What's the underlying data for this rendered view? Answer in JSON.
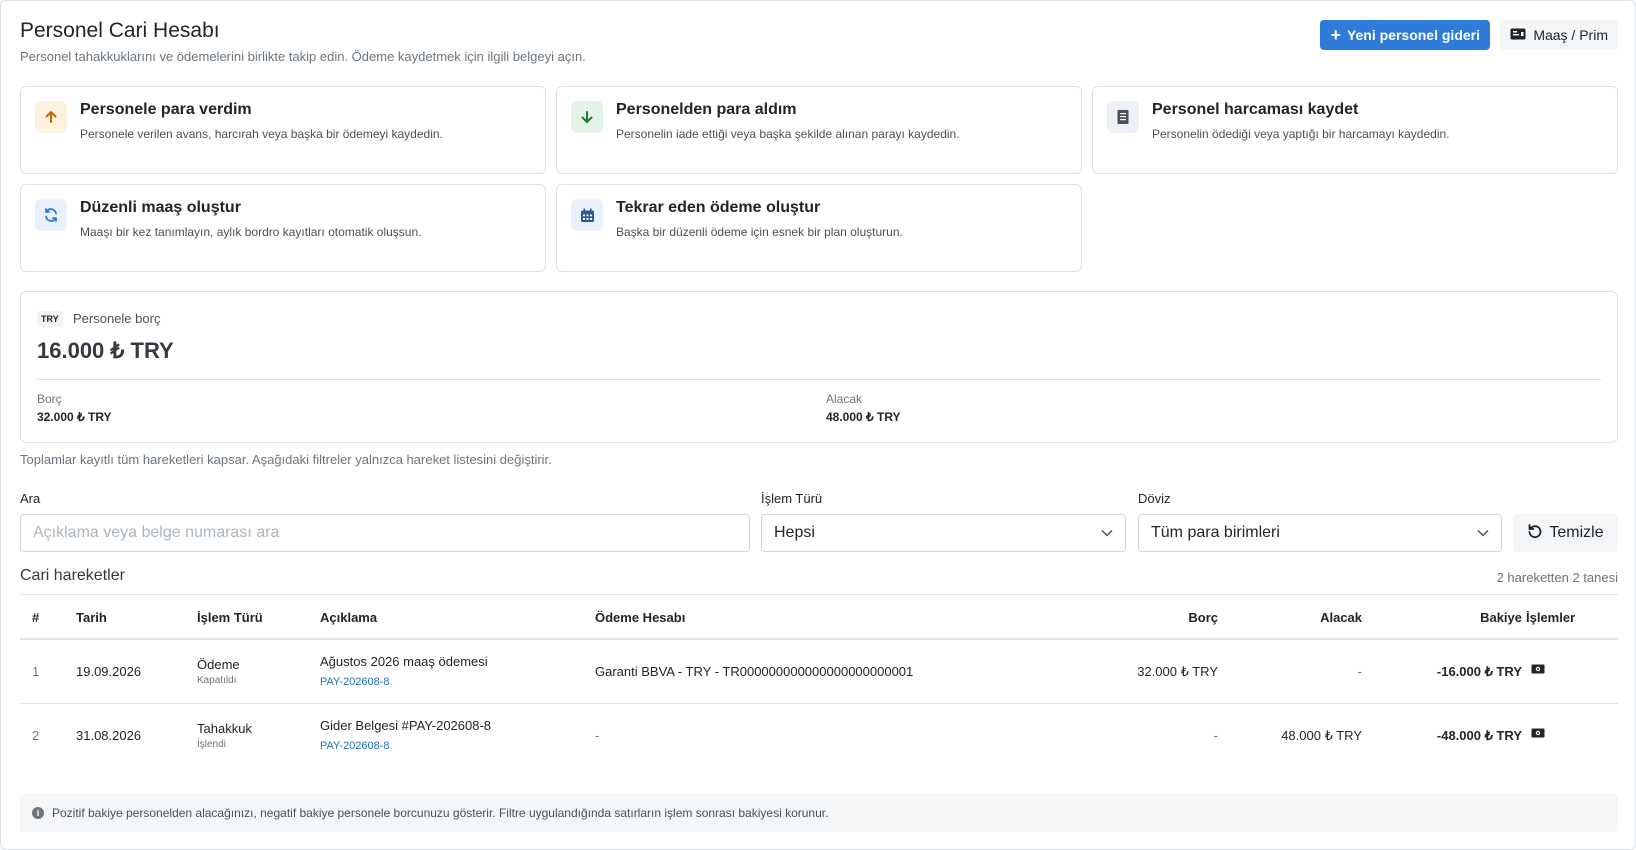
{
  "header": {
    "title": "Personel Cari Hesabı",
    "subtitle": "Personel tahakkuklarını ve ödemelerini birlikte takip edin. Ödeme kaydetmek için ilgili belgeyi açın.",
    "new_expense_label": "Yeni personel gideri",
    "salary_label": "Maaş / Prim"
  },
  "actions": [
    {
      "title": "Personele para verdim",
      "desc": "Personele verilen avans, harcırah veya başka bir ödemeyi kaydedin.",
      "icon": "arrow-up-icon"
    },
    {
      "title": "Personelden para aldım",
      "desc": "Personelin iade ettiği veya başka şekilde alınan parayı kaydedin.",
      "icon": "arrow-down-icon"
    },
    {
      "title": "Personel harcaması kaydet",
      "desc": "Personelin ödediği veya yaptığı bir harcamayı kaydedin.",
      "icon": "receipt-icon"
    },
    {
      "title": "Düzenli maaş oluştur",
      "desc": "Maaşı bir kez tanımlayın, aylık bordro kayıtları otomatik oluşsun.",
      "icon": "refresh-icon"
    },
    {
      "title": "Tekrar eden ödeme oluştur",
      "desc": "Başka bir düzenli ödeme için esnek bir plan oluşturun.",
      "icon": "calendar-icon"
    }
  ],
  "balance": {
    "currency": "TRY",
    "label": "Personele borç",
    "amount": "16.000 ₺ TRY",
    "debit_label": "Borç",
    "debit_value": "32.000 ₺ TRY",
    "credit_label": "Alacak",
    "credit_value": "48.000 ₺ TRY"
  },
  "totals_note": "Toplamlar kayıtlı tüm hareketleri kapsar. Aşağıdaki filtreler yalnızca hareket listesini değiştirir.",
  "filters": {
    "search_label": "Ara",
    "search_placeholder": "Açıklama veya belge numarası ara",
    "type_label": "İşlem Türü",
    "type_value": "Hepsi",
    "currency_label": "Döviz",
    "currency_value": "Tüm para birimleri",
    "clear_label": "Temizle"
  },
  "movements": {
    "title": "Cari hareketler",
    "count": "2 hareketten 2 tanesi",
    "columns": [
      "#",
      "Tarih",
      "İşlem Türü",
      "Açıklama",
      "Ödeme Hesabı",
      "Borç",
      "Alacak",
      "Bakiye",
      "İşlemler"
    ],
    "rows": [
      {
        "no": "1",
        "date": "19.09.2026",
        "type": "Ödeme",
        "status": "Kapatıldı",
        "desc": "Ağustos 2026 maaş ödemesi",
        "ref": "PAY-202608-8",
        "account": "Garanti BBVA - TRY - TR000000000000000000000001",
        "debit": "32.000 ₺ TRY",
        "credit": "-",
        "balance": "-16.000 ₺ TRY"
      },
      {
        "no": "2",
        "date": "31.08.2026",
        "type": "Tahakkuk",
        "status": "İşlendi",
        "desc": "Gider Belgesi #PAY-202608-8",
        "ref": "PAY-202608-8",
        "account": "-",
        "debit": "-",
        "credit": "48.000 ₺ TRY",
        "balance": "-48.000 ₺ TRY"
      }
    ]
  },
  "footnote": "Pozitif bakiye personelden alacağınızı, negatif bakiye personele borcunuzu gösterir. Filtre uygulandığında satırların işlem sonrası bakiyesi korunur.",
  "colors": {
    "primary": "#2f7bd9",
    "link": "#1f6fc7",
    "up_bg": "#fff1e0",
    "up_fg": "#b86a00",
    "down_bg": "#e3f3e6",
    "down_fg": "#1d7a36"
  }
}
